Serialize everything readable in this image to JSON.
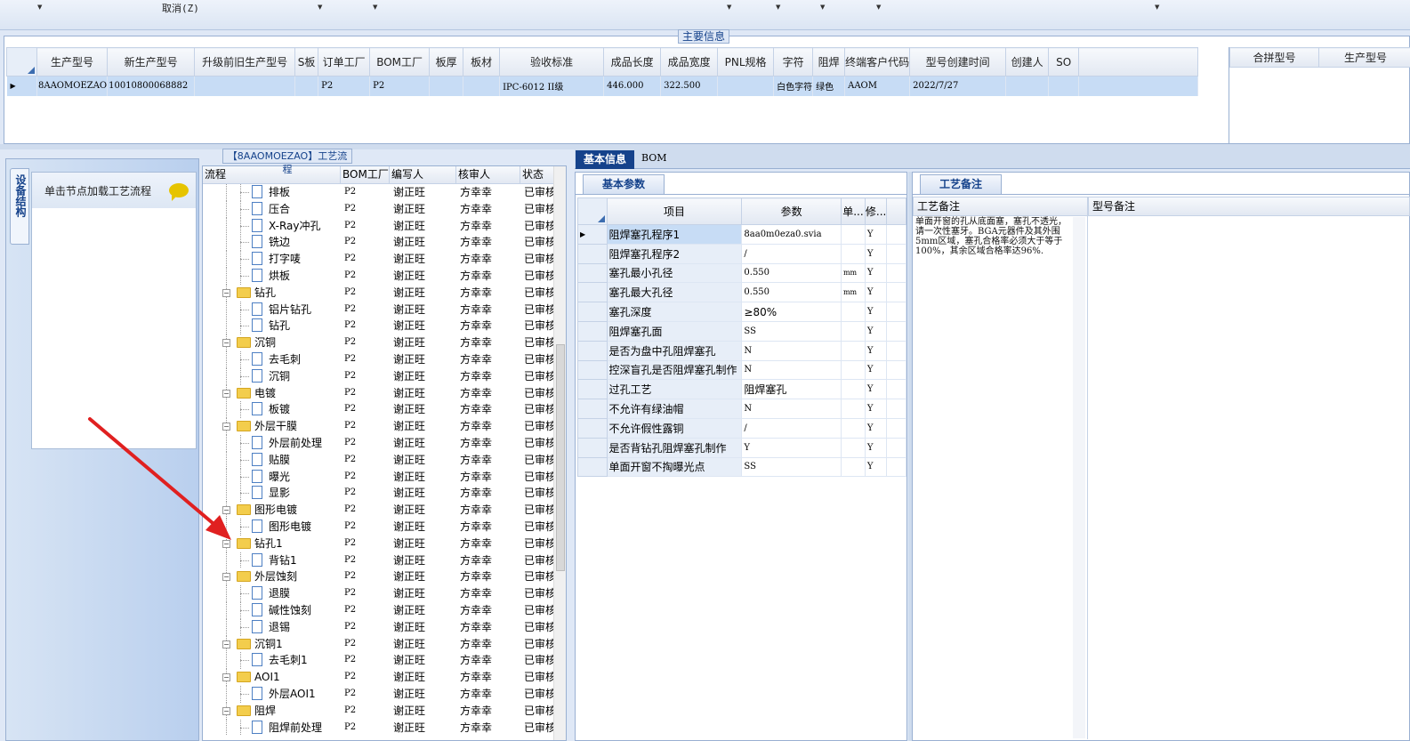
{
  "toolbar": {
    "cancel_label": "取消(Z)"
  },
  "main_info": {
    "title": "主要信息",
    "columns": [
      "生产型号",
      "新生产型号",
      "升级前旧生产型号",
      "S板",
      "订单工厂",
      "BOM工厂",
      "板厚",
      "板材",
      "验收标准",
      "成品长度",
      "成品宽度",
      "PNL规格",
      "字符",
      "阻焊",
      "终端客户代码",
      "型号创建时间",
      "创建人",
      "SO"
    ],
    "row": [
      "8AAOMOEZAO",
      "10010800068882",
      "",
      "",
      "P2",
      "P2",
      "",
      "",
      "IPC-6012 II级",
      "446.000",
      "322.500",
      "",
      "白色字符",
      "绿色",
      "AAOM",
      "2022/7/27",
      "",
      ""
    ],
    "merge_columns": [
      "合拼型号",
      "生产型号"
    ]
  },
  "left_nav": {
    "vertical_tab": "设备结构",
    "card_title": "单击节点加载工艺流程",
    "chat_icon": "chat-bubble-icon"
  },
  "flow": {
    "title": "【8AAOMOEZAO】工艺流程",
    "columns": [
      "流程",
      "BOM工厂",
      "编写人",
      "核审人",
      "状态"
    ],
    "rows": [
      {
        "name": "排板",
        "type": "file",
        "bom": "P2",
        "writer": "谢正旺",
        "reviewer": "方幸幸",
        "status": "已审核"
      },
      {
        "name": "压合",
        "type": "file",
        "bom": "P2",
        "writer": "谢正旺",
        "reviewer": "方幸幸",
        "status": "已审核"
      },
      {
        "name": "X-Ray冲孔",
        "type": "file",
        "bom": "P2",
        "writer": "谢正旺",
        "reviewer": "方幸幸",
        "status": "已审核"
      },
      {
        "name": "铣边",
        "type": "file",
        "bom": "P2",
        "writer": "谢正旺",
        "reviewer": "方幸幸",
        "status": "已审核"
      },
      {
        "name": "打字唛",
        "type": "file",
        "bom": "P2",
        "writer": "谢正旺",
        "reviewer": "方幸幸",
        "status": "已审核"
      },
      {
        "name": "烘板",
        "type": "file",
        "bom": "P2",
        "writer": "谢正旺",
        "reviewer": "方幸幸",
        "status": "已审核"
      },
      {
        "name": "钻孔",
        "type": "folder",
        "bom": "P2",
        "writer": "谢正旺",
        "reviewer": "方幸幸",
        "status": "已审核"
      },
      {
        "name": "铝片钻孔",
        "type": "file",
        "bom": "P2",
        "writer": "谢正旺",
        "reviewer": "方幸幸",
        "status": "已审核"
      },
      {
        "name": "钻孔",
        "type": "file",
        "bom": "P2",
        "writer": "谢正旺",
        "reviewer": "方幸幸",
        "status": "已审核"
      },
      {
        "name": "沉铜",
        "type": "folder",
        "bom": "P2",
        "writer": "谢正旺",
        "reviewer": "方幸幸",
        "status": "已审核"
      },
      {
        "name": "去毛刺",
        "type": "file",
        "bom": "P2",
        "writer": "谢正旺",
        "reviewer": "方幸幸",
        "status": "已审核"
      },
      {
        "name": "沉铜",
        "type": "file",
        "bom": "P2",
        "writer": "谢正旺",
        "reviewer": "方幸幸",
        "status": "已审核"
      },
      {
        "name": "电镀",
        "type": "folder",
        "bom": "P2",
        "writer": "谢正旺",
        "reviewer": "方幸幸",
        "status": "已审核"
      },
      {
        "name": "板镀",
        "type": "file",
        "bom": "P2",
        "writer": "谢正旺",
        "reviewer": "方幸幸",
        "status": "已审核"
      },
      {
        "name": "外层干膜",
        "type": "folder",
        "bom": "P2",
        "writer": "谢正旺",
        "reviewer": "方幸幸",
        "status": "已审核"
      },
      {
        "name": "外层前处理",
        "type": "file",
        "bom": "P2",
        "writer": "谢正旺",
        "reviewer": "方幸幸",
        "status": "已审核"
      },
      {
        "name": "贴膜",
        "type": "file",
        "bom": "P2",
        "writer": "谢正旺",
        "reviewer": "方幸幸",
        "status": "已审核"
      },
      {
        "name": "曝光",
        "type": "file",
        "bom": "P2",
        "writer": "谢正旺",
        "reviewer": "方幸幸",
        "status": "已审核"
      },
      {
        "name": "显影",
        "type": "file",
        "bom": "P2",
        "writer": "谢正旺",
        "reviewer": "方幸幸",
        "status": "已审核"
      },
      {
        "name": "图形电镀",
        "type": "folder",
        "bom": "P2",
        "writer": "谢正旺",
        "reviewer": "方幸幸",
        "status": "已审核"
      },
      {
        "name": "图形电镀",
        "type": "file",
        "bom": "P2",
        "writer": "谢正旺",
        "reviewer": "方幸幸",
        "status": "已审核"
      },
      {
        "name": "钻孔1",
        "type": "folder",
        "bom": "P2",
        "writer": "谢正旺",
        "reviewer": "方幸幸",
        "status": "已审核"
      },
      {
        "name": "背钻1",
        "type": "file",
        "bom": "P2",
        "writer": "谢正旺",
        "reviewer": "方幸幸",
        "status": "已审核"
      },
      {
        "name": "外层蚀刻",
        "type": "folder",
        "bom": "P2",
        "writer": "谢正旺",
        "reviewer": "方幸幸",
        "status": "已审核"
      },
      {
        "name": "退膜",
        "type": "file",
        "bom": "P2",
        "writer": "谢正旺",
        "reviewer": "方幸幸",
        "status": "已审核"
      },
      {
        "name": "碱性蚀刻",
        "type": "file",
        "bom": "P2",
        "writer": "谢正旺",
        "reviewer": "方幸幸",
        "status": "已审核"
      },
      {
        "name": "退锡",
        "type": "file",
        "bom": "P2",
        "writer": "谢正旺",
        "reviewer": "方幸幸",
        "status": "已审核"
      },
      {
        "name": "沉铜1",
        "type": "folder",
        "bom": "P2",
        "writer": "谢正旺",
        "reviewer": "方幸幸",
        "status": "已审核"
      },
      {
        "name": "去毛刺1",
        "type": "file",
        "bom": "P2",
        "writer": "谢正旺",
        "reviewer": "方幸幸",
        "status": "已审核"
      },
      {
        "name": "AOI1",
        "type": "folder",
        "bom": "P2",
        "writer": "谢正旺",
        "reviewer": "方幸幸",
        "status": "已审核"
      },
      {
        "name": "外层AOI1",
        "type": "file",
        "bom": "P2",
        "writer": "谢正旺",
        "reviewer": "方幸幸",
        "status": "已审核"
      },
      {
        "name": "阻焊",
        "type": "folder",
        "bom": "P2",
        "writer": "谢正旺",
        "reviewer": "方幸幸",
        "status": "已审核"
      },
      {
        "name": "阻焊前处理",
        "type": "file",
        "bom": "P2",
        "writer": "谢正旺",
        "reviewer": "方幸幸",
        "status": "已审核"
      }
    ]
  },
  "middle": {
    "tabs": [
      "基本信息",
      "BOM"
    ],
    "sub_tab": "基本参数",
    "columns": [
      "项目",
      "参数",
      "单...",
      "修..."
    ],
    "rows": [
      {
        "item": "阻焊塞孔程序1",
        "param": "8aa0m0eza0.svia",
        "unit": "",
        "mod": "Y"
      },
      {
        "item": "阻焊塞孔程序2",
        "param": "/",
        "unit": "",
        "mod": "Y"
      },
      {
        "item": "塞孔最小孔径",
        "param": "0.550",
        "unit": "mm",
        "mod": "Y"
      },
      {
        "item": "塞孔最大孔径",
        "param": "0.550",
        "unit": "mm",
        "mod": "Y"
      },
      {
        "item": "塞孔深度",
        "param": "≥80%",
        "unit": "",
        "mod": "Y"
      },
      {
        "item": "阻焊塞孔面",
        "param": "SS",
        "unit": "",
        "mod": "Y"
      },
      {
        "item": "是否为盘中孔阻焊塞孔",
        "param": "N",
        "unit": "",
        "mod": "Y"
      },
      {
        "item": "控深盲孔是否阻焊塞孔制作",
        "param": "N",
        "unit": "",
        "mod": "Y"
      },
      {
        "item": "过孔工艺",
        "param": "阻焊塞孔",
        "unit": "",
        "mod": "Y"
      },
      {
        "item": "不允许有绿油帽",
        "param": "N",
        "unit": "",
        "mod": "Y"
      },
      {
        "item": "不允许假性露铜",
        "param": "/",
        "unit": "",
        "mod": "Y"
      },
      {
        "item": "是否背钻孔阻焊塞孔制作",
        "param": "Y",
        "unit": "",
        "mod": "Y"
      },
      {
        "item": "单面开窗不掏曝光点",
        "param": "SS",
        "unit": "",
        "mod": "Y"
      }
    ]
  },
  "notes": {
    "tab": "工艺备注",
    "col_process": "工艺备注",
    "col_model": "型号备注",
    "process_note": "单面开窗的孔从底面塞，塞孔不透光，请一次性塞牙。BGA元器件及其外围5mm区域，塞孔合格率必须大于等于100%，其余区域合格率达96%."
  },
  "colors": {
    "accent": "#15428b",
    "selected_row": "#c7dcf5",
    "arrow": "#e02020"
  }
}
